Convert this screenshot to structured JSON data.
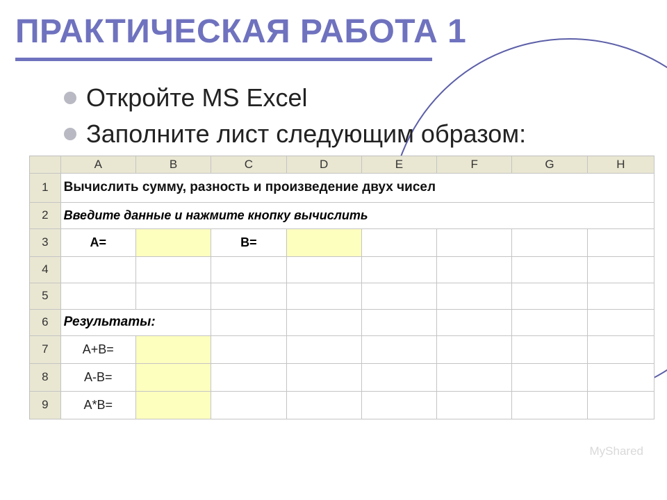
{
  "title": "ПРАКТИЧЕСКАЯ РАБОТА 1",
  "bullets": [
    "Откройте MS Excel",
    "Заполните лист следующим образом:"
  ],
  "sheet": {
    "columns": [
      "",
      "A",
      "B",
      "C",
      "D",
      "E",
      "F",
      "G",
      "H"
    ],
    "rows": [
      "1",
      "2",
      "3",
      "4",
      "5",
      "6",
      "7",
      "8",
      "9"
    ],
    "r1_text": "Вычислить сумму, разность и произведение двух чисел",
    "r2_text": "Введите данные и нажмите кнопку вычислить",
    "r3_a": "A=",
    "r3_c": "B=",
    "r6_a": "Результаты:",
    "r7_a": "A+B=",
    "r8_a": "A-B=",
    "r9_a": "A*B="
  },
  "watermark": "MyShared"
}
